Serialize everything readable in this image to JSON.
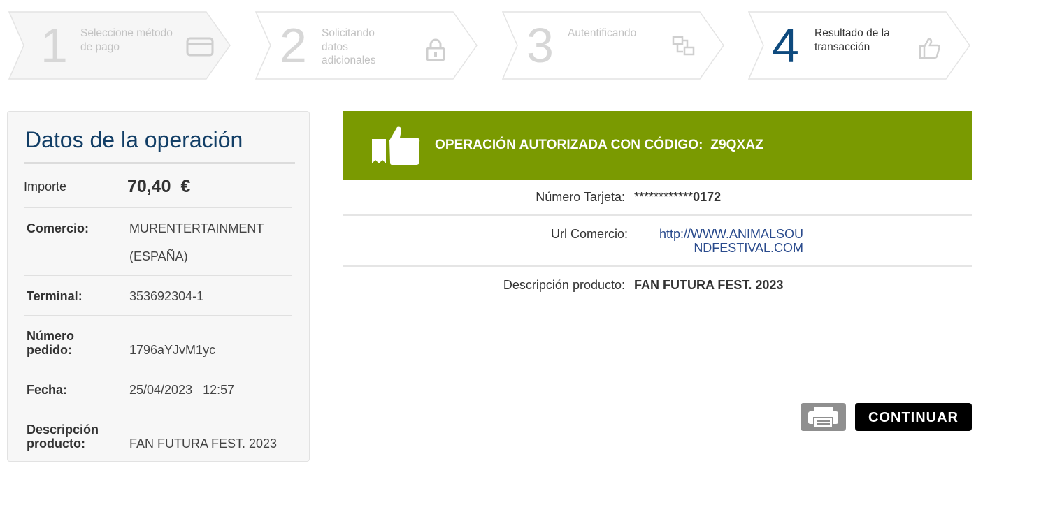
{
  "steps": [
    {
      "number": "1",
      "label": "Seleccione método de pago",
      "icon": "credit-card-icon"
    },
    {
      "number": "2",
      "label": "Solicitando datos adicionales",
      "icon": "lock-icon"
    },
    {
      "number": "3",
      "label": "Autentificando",
      "icon": "exchange-icon"
    },
    {
      "number": "4",
      "label": "Resultado de la transacción",
      "icon": "thumbs-up-icon",
      "active": true
    }
  ],
  "panel": {
    "title": "Datos de la operación",
    "importe_label": "Importe",
    "importe_value": "70,40  €",
    "comercio_label": "Comercio:",
    "comercio_value_1": "MURENTERTAINMENT",
    "comercio_value_2": "(ESPAÑA)",
    "terminal_label": "Terminal:",
    "terminal_value": "353692304-1",
    "pedido_label_1": "Número",
    "pedido_label_2": "pedido:",
    "pedido_value": "1796aYJvM1yc",
    "fecha_label": "Fecha:",
    "fecha_value": "25/04/2023   12:57",
    "descripcion_label_1": "Descripción",
    "descripcion_label_2": "producto:",
    "descripcion_value": "FAN FUTURA FEST. 2023"
  },
  "result": {
    "banner_text": "OPERACIÓN AUTORIZADA CON CÓDIGO:  Z9QXAZ",
    "tarjeta_label": "Número Tarjeta:",
    "tarjeta_mask": "************",
    "tarjeta_last": "0172",
    "url_label": "Url Comercio:",
    "url_line_1": "http://WWW.ANIMALSOU",
    "url_line_2": "NDFESTIVAL.COM",
    "descripcion_label": "Descripción producto:",
    "descripcion_value": "FAN FUTURA FEST. 2023"
  },
  "actions": {
    "print_icon": "printer-icon",
    "continue_label": "CONTINUAR"
  },
  "colors": {
    "accent_blue": "#0e4a7e",
    "banner_green": "#7a9a01"
  }
}
